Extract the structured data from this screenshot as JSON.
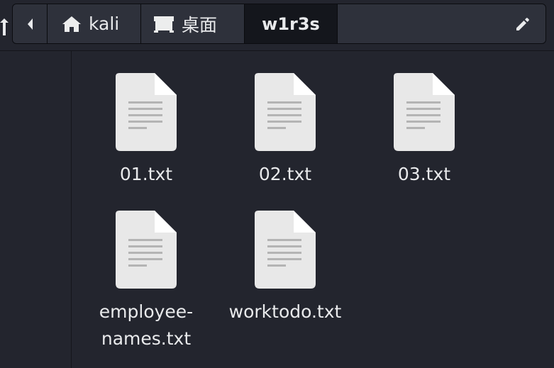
{
  "pathbar": {
    "home_label": "kali",
    "desktop_label": "桌面",
    "current_label": "w1r3s"
  },
  "files": [
    {
      "name": "01.txt",
      "icon": "text-file-icon"
    },
    {
      "name": "02.txt",
      "icon": "text-file-icon"
    },
    {
      "name": "03.txt",
      "icon": "text-file-icon"
    },
    {
      "name": "employee-names.txt",
      "name_line1": "employee-",
      "name_line2": "names.txt",
      "icon": "text-file-icon"
    },
    {
      "name": "worktodo.txt",
      "icon": "text-file-icon"
    }
  ],
  "colors": {
    "background": "#23252e",
    "pathbar_crumb": "#2e313b",
    "pathbar_active": "#14161c",
    "file_icon": "#e8e8e8",
    "text": "#e9eaec"
  }
}
